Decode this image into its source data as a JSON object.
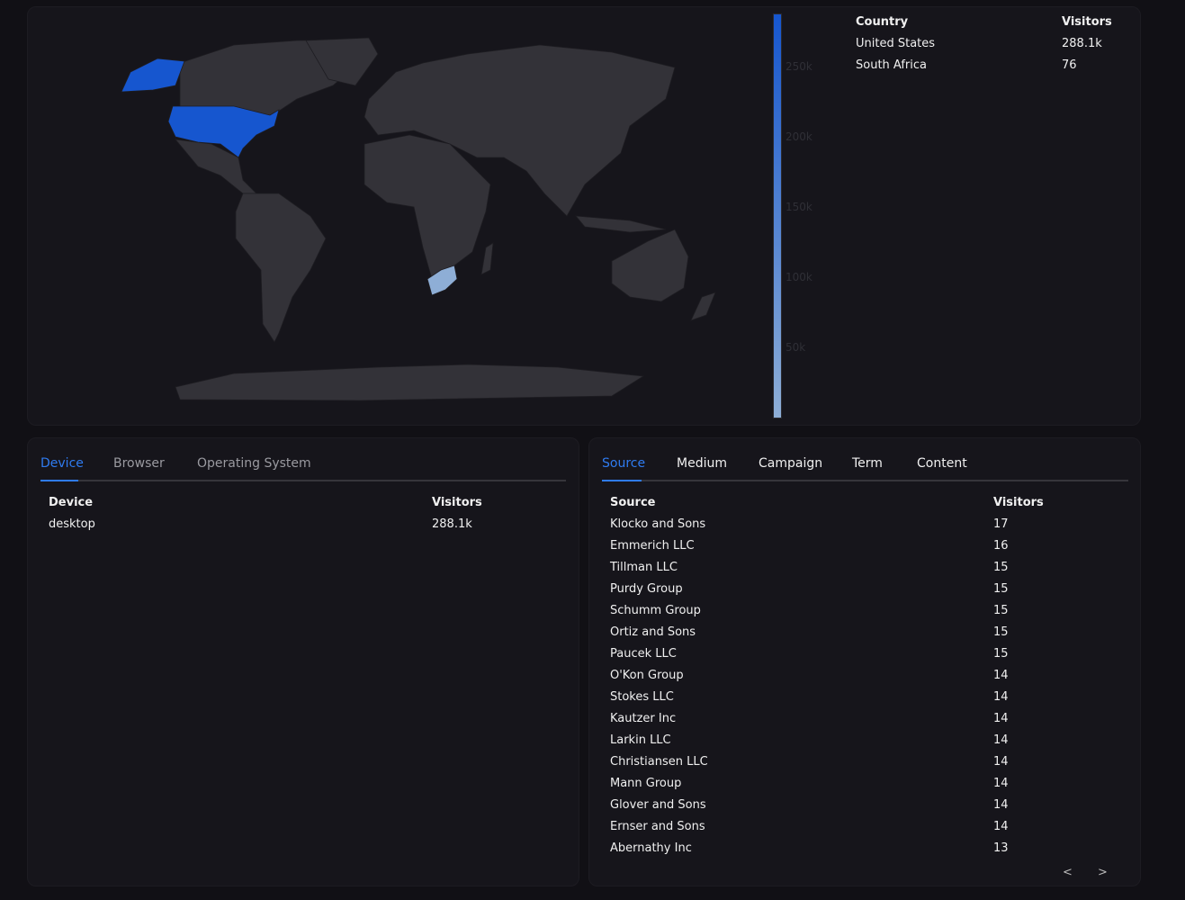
{
  "map": {
    "colors": {
      "high": "#1656cf",
      "low": "#8eaed6",
      "land": "#333238",
      "background": "#16151b"
    },
    "highlighted": [
      "United States",
      "South Africa"
    ],
    "scale_ticks": [
      "250k",
      "200k",
      "150k",
      "100k",
      "50k"
    ]
  },
  "countries": {
    "headers": {
      "name": "Country",
      "value": "Visitors"
    },
    "rows": [
      {
        "name": "United States",
        "value": "288.1k"
      },
      {
        "name": "South Africa",
        "value": "76"
      }
    ]
  },
  "device_panel": {
    "tabs": [
      "Device",
      "Browser",
      "Operating System"
    ],
    "active_tab": "Device",
    "headers": {
      "name": "Device",
      "value": "Visitors"
    },
    "rows": [
      {
        "name": "desktop",
        "value": "288.1k"
      }
    ]
  },
  "source_panel": {
    "tabs": [
      "Source",
      "Medium",
      "Campaign",
      "Term",
      "Content"
    ],
    "active_tab": "Source",
    "headers": {
      "name": "Source",
      "value": "Visitors"
    },
    "rows": [
      {
        "name": "Klocko and Sons",
        "value": "17"
      },
      {
        "name": "Emmerich LLC",
        "value": "16"
      },
      {
        "name": "Tillman LLC",
        "value": "15"
      },
      {
        "name": "Purdy Group",
        "value": "15"
      },
      {
        "name": "Schumm Group",
        "value": "15"
      },
      {
        "name": "Ortiz and Sons",
        "value": "15"
      },
      {
        "name": "Paucek LLC",
        "value": "15"
      },
      {
        "name": "O'Kon Group",
        "value": "14"
      },
      {
        "name": "Stokes LLC",
        "value": "14"
      },
      {
        "name": "Kautzer Inc",
        "value": "14"
      },
      {
        "name": "Larkin LLC",
        "value": "14"
      },
      {
        "name": "Christiansen LLC",
        "value": "14"
      },
      {
        "name": "Mann Group",
        "value": "14"
      },
      {
        "name": "Glover and Sons",
        "value": "14"
      },
      {
        "name": "Ernser and Sons",
        "value": "14"
      },
      {
        "name": "Abernathy Inc",
        "value": "13"
      }
    ],
    "pagination": {
      "prev": "<",
      "next": ">"
    }
  }
}
